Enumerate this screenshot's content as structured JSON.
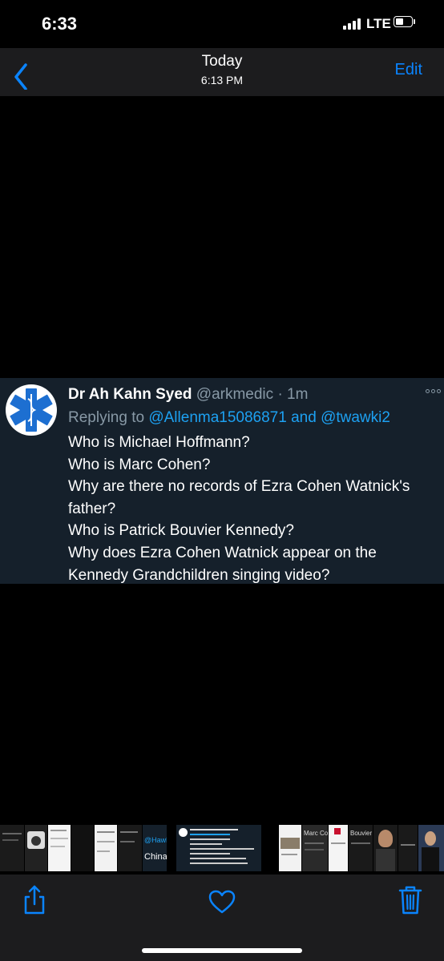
{
  "status_bar": {
    "time": "6:33",
    "network": "LTE"
  },
  "nav": {
    "title": "Today",
    "subtitle": "6:13 PM",
    "edit_label": "Edit"
  },
  "tweet": {
    "display_name": "Dr Ah Kahn Syed",
    "handle": "@arkmedic",
    "separator": "·",
    "age": "1m",
    "replying_prefix": "Replying to",
    "mention_1": "@Allenma15086871",
    "conjunction": "and",
    "mention_2": "@twawki2",
    "lines": [
      "Who is Michael Hoffmann?",
      "Who is Marc Cohen?",
      "Why are there no records of Ezra Cohen Watnick's",
      "father?",
      "Who is Patrick Bouvier Kennedy?",
      "Why does Ezra Cohen Watnick appear on the",
      "Kennedy Grandchildren singing video?"
    ]
  },
  "thumbnails": {
    "hawley_fragment": "@Hawley",
    "china_fragment": "China",
    "marc_cohen_fragment": "Marc Cohen",
    "bouvier_fragment": "Bouvier K"
  },
  "colors": {
    "accent": "#0a84ff",
    "twitter_blue": "#1da1f2",
    "tweet_bg": "#15202b",
    "muted": "#8899a6",
    "bar_bg": "#1c1c1e"
  },
  "icons": {
    "back": "chevron-left-icon",
    "share": "share-icon",
    "like": "heart-icon",
    "delete": "trash-icon",
    "more": "more-icon"
  }
}
